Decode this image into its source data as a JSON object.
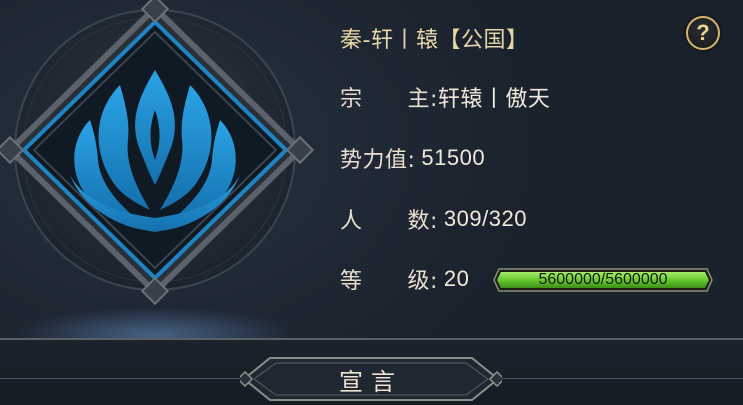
{
  "guild": {
    "name": "秦-轩丨辕【公国】"
  },
  "info": {
    "leader_label": "宗　　主:",
    "leader_value": "轩辕丨傲天",
    "power_label": "势力值:",
    "power_value": "51500",
    "members_label": "人　　数:",
    "members_value": "309/320",
    "level_label": "等　　级:",
    "level_value": "20",
    "exp_text": "5600000/5600000",
    "exp_fraction": 1.0
  },
  "help_symbol": "?",
  "bottom": {
    "tab_label": "宣言"
  },
  "colors": {
    "emblem_blue": "#1f8fd0",
    "exp_green": "#6fd43a",
    "gold_frame": "#d8b56a"
  },
  "icons": {
    "emblem": "blue-flame-lotus-emblem",
    "help": "question-mark-icon"
  }
}
